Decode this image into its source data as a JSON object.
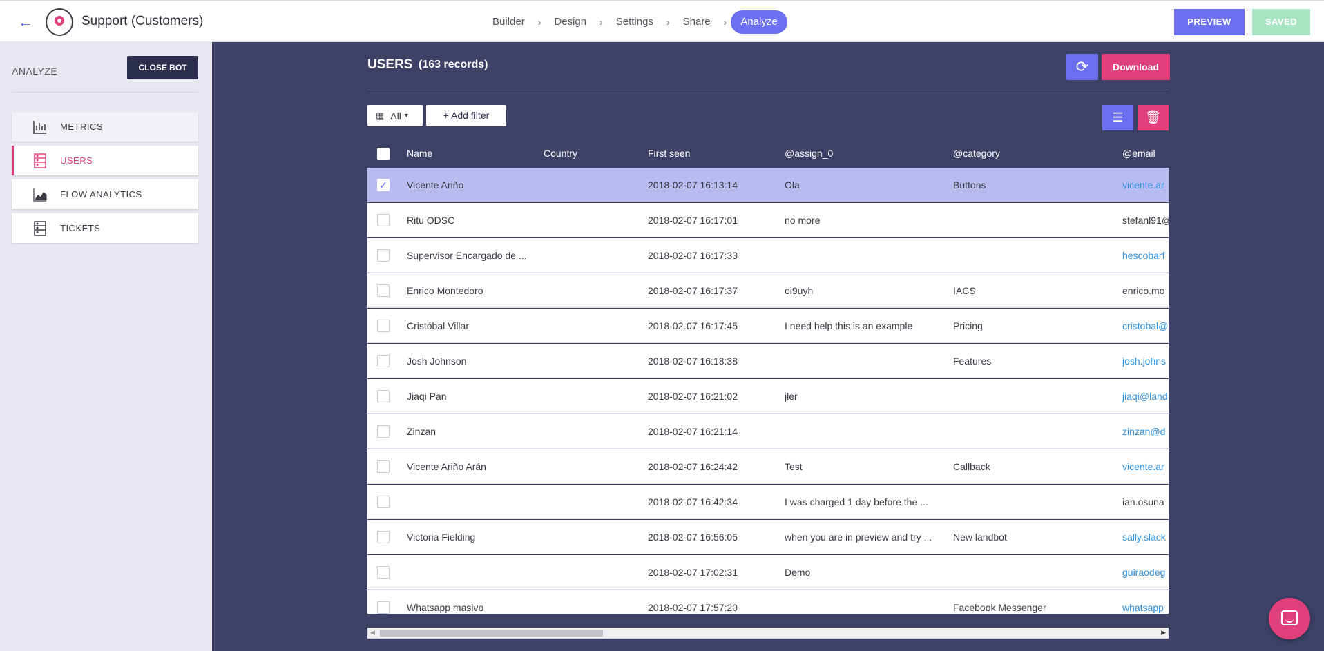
{
  "header": {
    "bot_title": "Support (Customers)",
    "steps": [
      "Builder",
      "Design",
      "Settings",
      "Share",
      "Analyze"
    ],
    "active_step": "Analyze",
    "preview_label": "PREVIEW",
    "saved_label": "SAVED"
  },
  "sidebar": {
    "section_label": "ANALYZE",
    "close_label": "CLOSE BOT",
    "items": [
      {
        "label": "METRICS",
        "icon": "bar-chart-icon"
      },
      {
        "label": "USERS",
        "icon": "users-list-icon"
      },
      {
        "label": "FLOW ANALYTICS",
        "icon": "area-chart-icon"
      },
      {
        "label": "TICKETS",
        "icon": "tickets-icon"
      }
    ],
    "active": "USERS"
  },
  "main": {
    "title": "USERS",
    "records": "(163 records)",
    "download_label": "Download",
    "date_filter": "All",
    "add_filter_label": "+ Add filter"
  },
  "table": {
    "columns": [
      "Name",
      "Country",
      "First seen",
      "@assign_0",
      "@category",
      "@email"
    ],
    "rows": [
      {
        "name": "Vicente Ariño",
        "country": "",
        "first": "2018-02-07 16:13:14",
        "assign": "Ola",
        "category": "Buttons",
        "email": "vicente.ar",
        "email_link": true,
        "selected": true
      },
      {
        "name": "Ritu ODSC",
        "country": "",
        "first": "2018-02-07 16:17:01",
        "assign": "no more",
        "category": "",
        "email": "stefanl91@",
        "email_link": false,
        "selected": false
      },
      {
        "name": "Supervisor Encargado de ...",
        "country": "",
        "first": "2018-02-07 16:17:33",
        "assign": "",
        "category": "",
        "email": "hescobarf",
        "email_link": true,
        "selected": false
      },
      {
        "name": "Enrico Montedoro",
        "country": "",
        "first": "2018-02-07 16:17:37",
        "assign": "oi9uyh",
        "category": "IACS",
        "email": "enrico.mo",
        "email_link": false,
        "selected": false
      },
      {
        "name": "Cristóbal Villar",
        "country": "",
        "first": "2018-02-07 16:17:45",
        "assign": "I need help this is an example",
        "category": "Pricing",
        "email": "cristobal@",
        "email_link": true,
        "selected": false
      },
      {
        "name": "Josh Johnson",
        "country": "",
        "first": "2018-02-07 16:18:38",
        "assign": "",
        "category": "Features",
        "email": "josh.johns",
        "email_link": true,
        "selected": false
      },
      {
        "name": "Jiaqi Pan",
        "country": "",
        "first": "2018-02-07 16:21:02",
        "assign": "jler",
        "category": "",
        "email": "jiaqi@land",
        "email_link": true,
        "selected": false
      },
      {
        "name": "Zinzan",
        "country": "",
        "first": "2018-02-07 16:21:14",
        "assign": "",
        "category": "",
        "email": "zinzan@d",
        "email_link": true,
        "selected": false
      },
      {
        "name": "Vicente Ariño Arán",
        "country": "",
        "first": "2018-02-07 16:24:42",
        "assign": "Test",
        "category": "Callback",
        "email": "vicente.ar",
        "email_link": true,
        "selected": false
      },
      {
        "name": "",
        "country": "",
        "first": "2018-02-07 16:42:34",
        "assign": "I was charged 1 day before the ...",
        "category": "",
        "email": "ian.osuna",
        "email_link": false,
        "selected": false
      },
      {
        "name": "Victoria Fielding",
        "country": "",
        "first": "2018-02-07 16:56:05",
        "assign": "when you are in preview and try ...",
        "category": "New landbot",
        "email": "sally.slack",
        "email_link": true,
        "selected": false
      },
      {
        "name": "",
        "country": "",
        "first": "2018-02-07 17:02:31",
        "assign": "Demo",
        "category": "",
        "email": "guiraodeg",
        "email_link": true,
        "selected": false
      },
      {
        "name": "Whatsapp masivo",
        "country": "",
        "first": "2018-02-07 17:57:20",
        "assign": "",
        "category": "Facebook Messenger",
        "email": "whatsapp",
        "email_link": true,
        "selected": false
      }
    ]
  },
  "colors": {
    "accent": "#6c6ff0",
    "pink": "#e0407a",
    "main_bg": "#3d4166",
    "selected_row": "#b8bbf0",
    "link": "#2b8fe0"
  }
}
